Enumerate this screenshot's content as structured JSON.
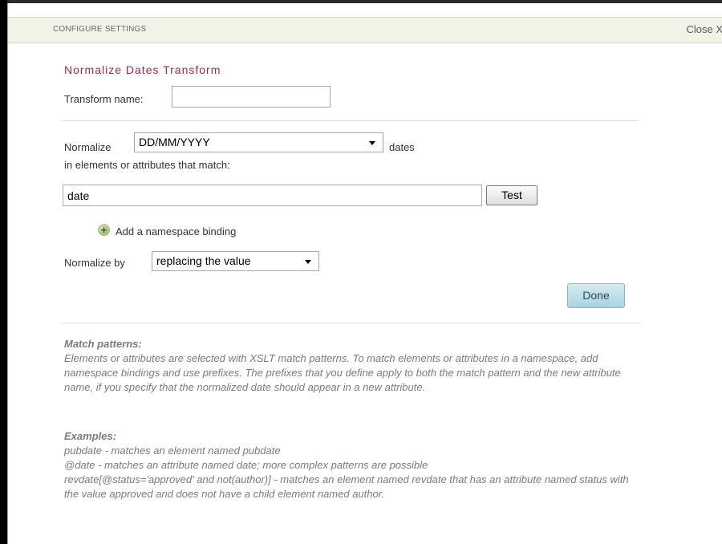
{
  "dialog": {
    "header_title": "CONFIGURE SETTINGS",
    "close_label": "Close X"
  },
  "transform": {
    "title": "Normalize Dates Transform",
    "name_label": "Transform name:",
    "name_value": ""
  },
  "normalize": {
    "prefix_label": "Normalize",
    "format_value": "DD/MM/YYYY",
    "suffix_label": "dates",
    "match_label": "in elements or attributes that match:",
    "pattern_value": "date",
    "test_button": "Test",
    "add_namespace_label": "Add a namespace binding",
    "by_label": "Normalize by",
    "by_value": "replacing the value",
    "done_button": "Done"
  },
  "help": {
    "match_heading": "Match patterns:",
    "match_text": "Elements or attributes are selected with XSLT match patterns. To match elements or attributes in a namespace, add namespace bindings and use prefixes. The prefixes that you define apply to both the match pattern and the new attribute name, if you specify that the normalized date should appear in a new attribute.",
    "examples_heading": "Examples:",
    "examples": [
      "pubdate - matches an element named pubdate",
      "@date - matches an attribute named date; more complex patterns are possible",
      "revdate[@status='approved' and not(author)] - matches an element named revdate that has an attribute named status with the value approved and does not have a child element named author."
    ]
  },
  "icons": {
    "add_namespace": "plus-circle-icon",
    "dropdown": "chevron-down-icon"
  },
  "colors": {
    "title": "#b0224a",
    "header_bg": "#f2f3e6",
    "done_button_bg": "#a9d3e2"
  }
}
